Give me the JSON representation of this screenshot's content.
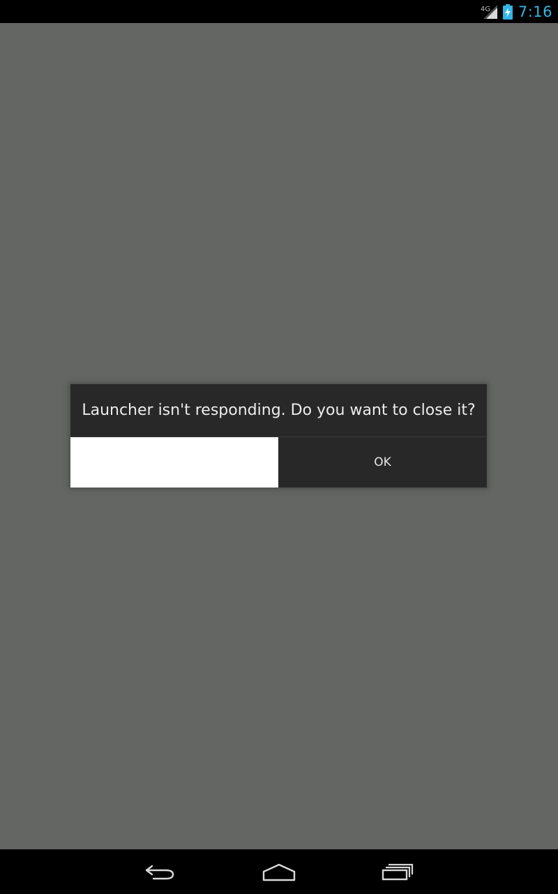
{
  "status_bar": {
    "network_type": "4G",
    "clock": "7:16",
    "icons": [
      "signal-icon",
      "battery-charging-icon"
    ],
    "clock_color": "#33b5e5"
  },
  "dialog": {
    "message": "Launcher isn't responding. Do you want to close it?",
    "left_button_label": "",
    "ok_label": "OK"
  },
  "nav_bar": {
    "icons": [
      "back-icon",
      "home-icon",
      "recent-apps-icon"
    ]
  },
  "colors": {
    "background": "#646664",
    "dialog_background": "#282828",
    "left_button_background": "#ffffff"
  }
}
